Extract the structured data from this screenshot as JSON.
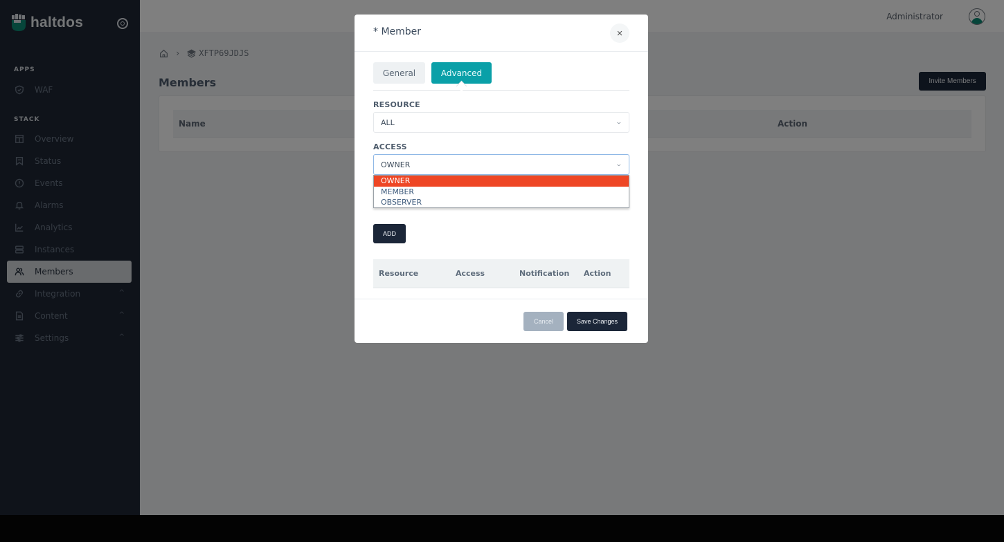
{
  "brand": {
    "name": "haltdos",
    "logo_color": "#0d8a74"
  },
  "sidebar": {
    "sections": [
      {
        "label": "APPS",
        "items": [
          {
            "label": "WAF",
            "icon": "shield-check-icon"
          }
        ]
      },
      {
        "label": "STACK",
        "items": [
          {
            "label": "Overview",
            "icon": "layout-icon"
          },
          {
            "label": "Status",
            "icon": "bookmark-icon"
          },
          {
            "label": "Events",
            "icon": "alert-circle-icon"
          },
          {
            "label": "Alarms",
            "icon": "bell-icon"
          },
          {
            "label": "Analytics",
            "icon": "chart-line-icon"
          },
          {
            "label": "Instances",
            "icon": "server-icon"
          },
          {
            "label": "Members",
            "icon": "users-icon",
            "active": true
          },
          {
            "label": "Integration",
            "icon": "link-icon",
            "expandable": true
          },
          {
            "label": "Content",
            "icon": "file-text-icon",
            "expandable": true
          },
          {
            "label": "Settings",
            "icon": "sliders-icon",
            "expandable": true
          }
        ]
      }
    ],
    "chevron": "^"
  },
  "topbar": {
    "user_name": "Administrator"
  },
  "breadcrumb": {
    "separator": "›",
    "stack_id": "XFTP69JDJS"
  },
  "page": {
    "title": "Members",
    "invite_button": "Invite Members",
    "table_columns": [
      "Name",
      "Action"
    ]
  },
  "modal": {
    "title": "* Member",
    "close_glyph": "×",
    "tabs": [
      {
        "label": "General"
      },
      {
        "label": "Advanced",
        "active": true
      }
    ],
    "resource": {
      "label": "RESOURCE",
      "value": "ALL"
    },
    "access": {
      "label": "ACCESS",
      "value": "OWNER",
      "options": [
        "OWNER",
        "MEMBER",
        "OBSERVER"
      ],
      "highlighted": "OWNER"
    },
    "caret": "⌄",
    "add_button": "ADD",
    "table_columns": [
      "Resource",
      "Access",
      "Notification",
      "Action"
    ],
    "cancel_button": "Cancel",
    "save_button": "Save Changes"
  }
}
